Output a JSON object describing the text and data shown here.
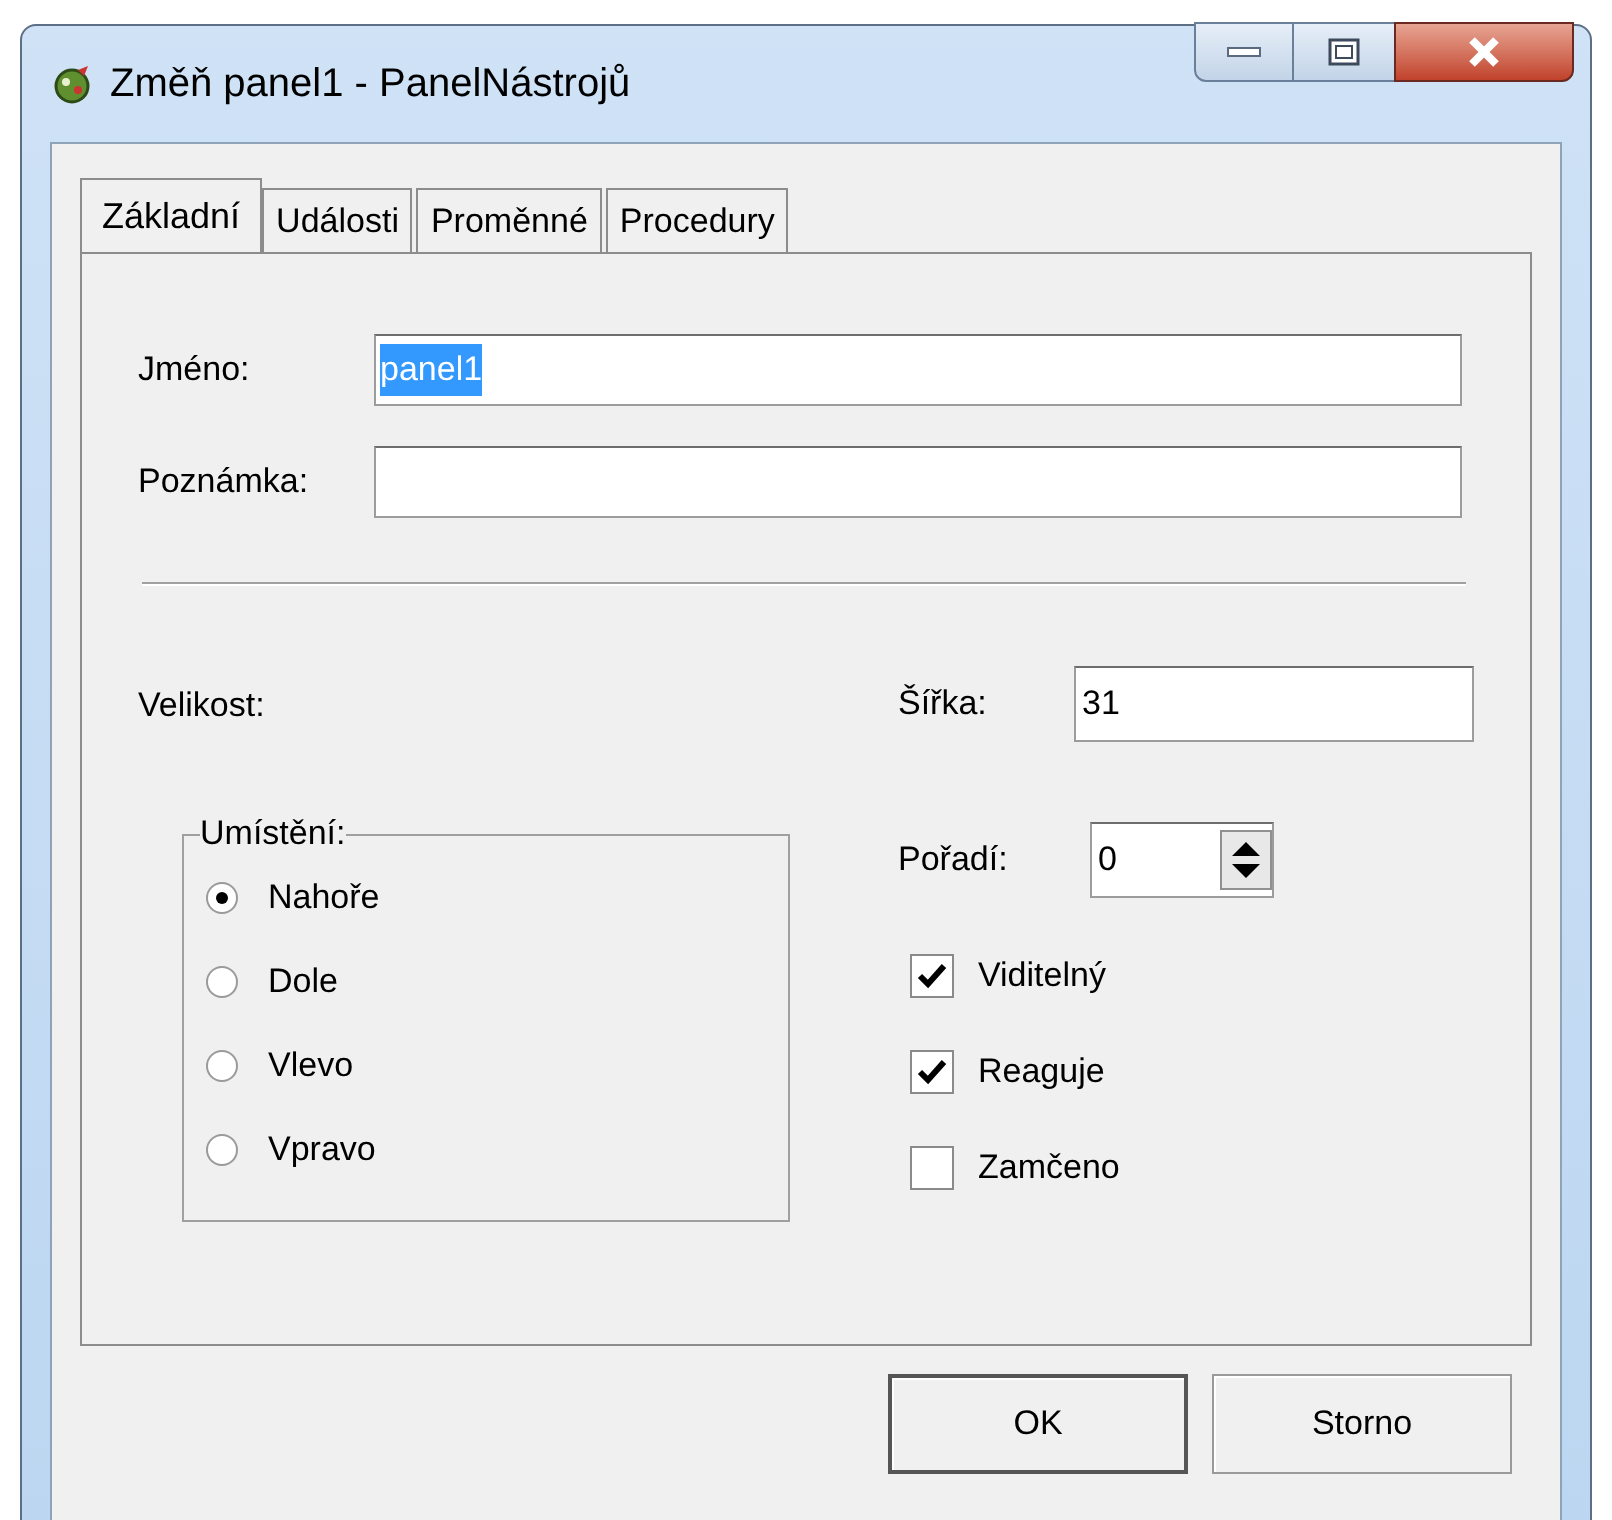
{
  "window": {
    "title": "Změň panel1  - PanelNástrojů"
  },
  "tabs": [
    {
      "label": "Základní",
      "selected": true
    },
    {
      "label": "Události",
      "selected": false
    },
    {
      "label": "Proměnné",
      "selected": false
    },
    {
      "label": "Procedury",
      "selected": false
    }
  ],
  "name_field": {
    "label": "Jméno:",
    "value": "panel1",
    "value_highlighted": true
  },
  "note_field": {
    "label": "Poznámka:"
  },
  "size_label": "Velikost:",
  "width_field": {
    "label": "Šířka:",
    "value": "31"
  },
  "placement": {
    "label": "Umístění:",
    "options": [
      {
        "label": "Nahoře",
        "selected": true
      },
      {
        "label": "Dole",
        "selected": false
      },
      {
        "label": "Vlevo",
        "selected": false
      },
      {
        "label": "Vpravo",
        "selected": false
      }
    ]
  },
  "order_field": {
    "label": "Pořadí:",
    "value": "0"
  },
  "checkboxes": [
    {
      "label": "Viditelný",
      "checked": true
    },
    {
      "label": "Reaguje",
      "checked": true
    },
    {
      "label": "Zamčeno",
      "checked": false
    }
  ],
  "buttons": [
    {
      "label": "OK",
      "default": true
    },
    {
      "label": "Storno",
      "default": false
    }
  ]
}
